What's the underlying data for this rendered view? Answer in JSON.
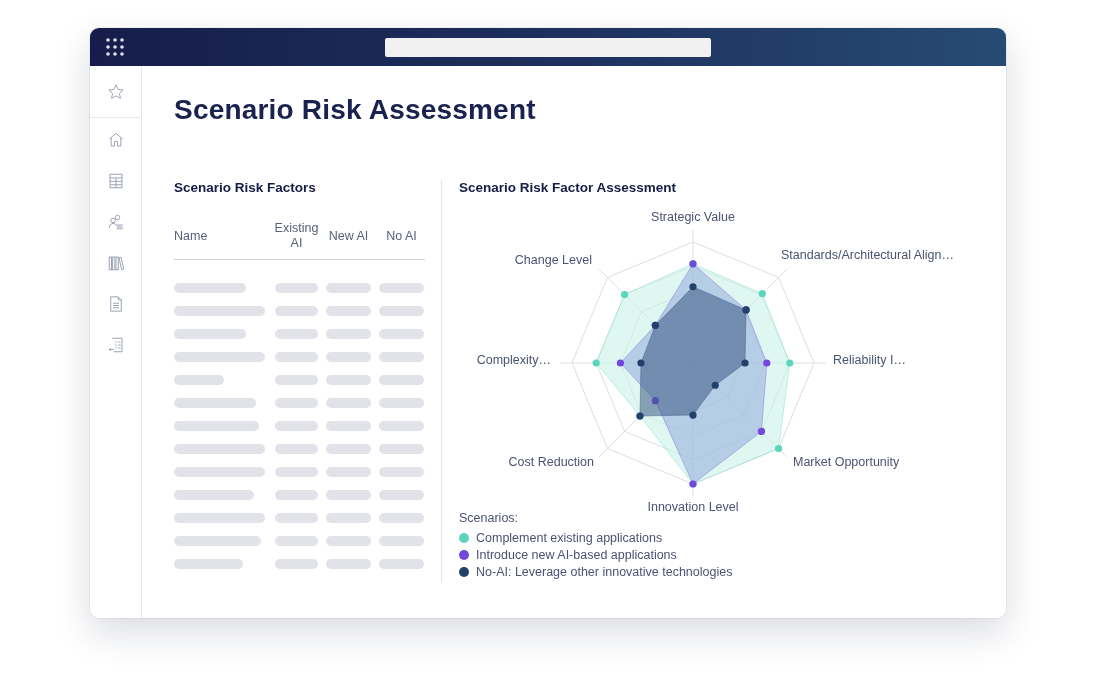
{
  "page": {
    "title": "Scenario Risk Assessment"
  },
  "factors": {
    "title": "Scenario Risk Factors",
    "columns": [
      "Name",
      "Existing AI",
      "New AI",
      "No AI"
    ]
  },
  "assessment": {
    "title": "Scenario Risk Factor Assessment",
    "axes": [
      "Strategic Value",
      "Standards/Architectural Align…",
      "Reliability I…",
      "Market Opportunity",
      "Innovation Level",
      "Cost Reduction",
      "Complexity…",
      "Change Level"
    ],
    "legend_title": "Scenarios:",
    "scenarios": [
      {
        "label": "Complement existing applications",
        "color": "#5ad6bf"
      },
      {
        "label": "Introduce new AI-based applications",
        "color": "#7248dc"
      },
      {
        "label": "No-AI: Leverage other innovative technologies",
        "color": "#21406a"
      }
    ]
  }
}
